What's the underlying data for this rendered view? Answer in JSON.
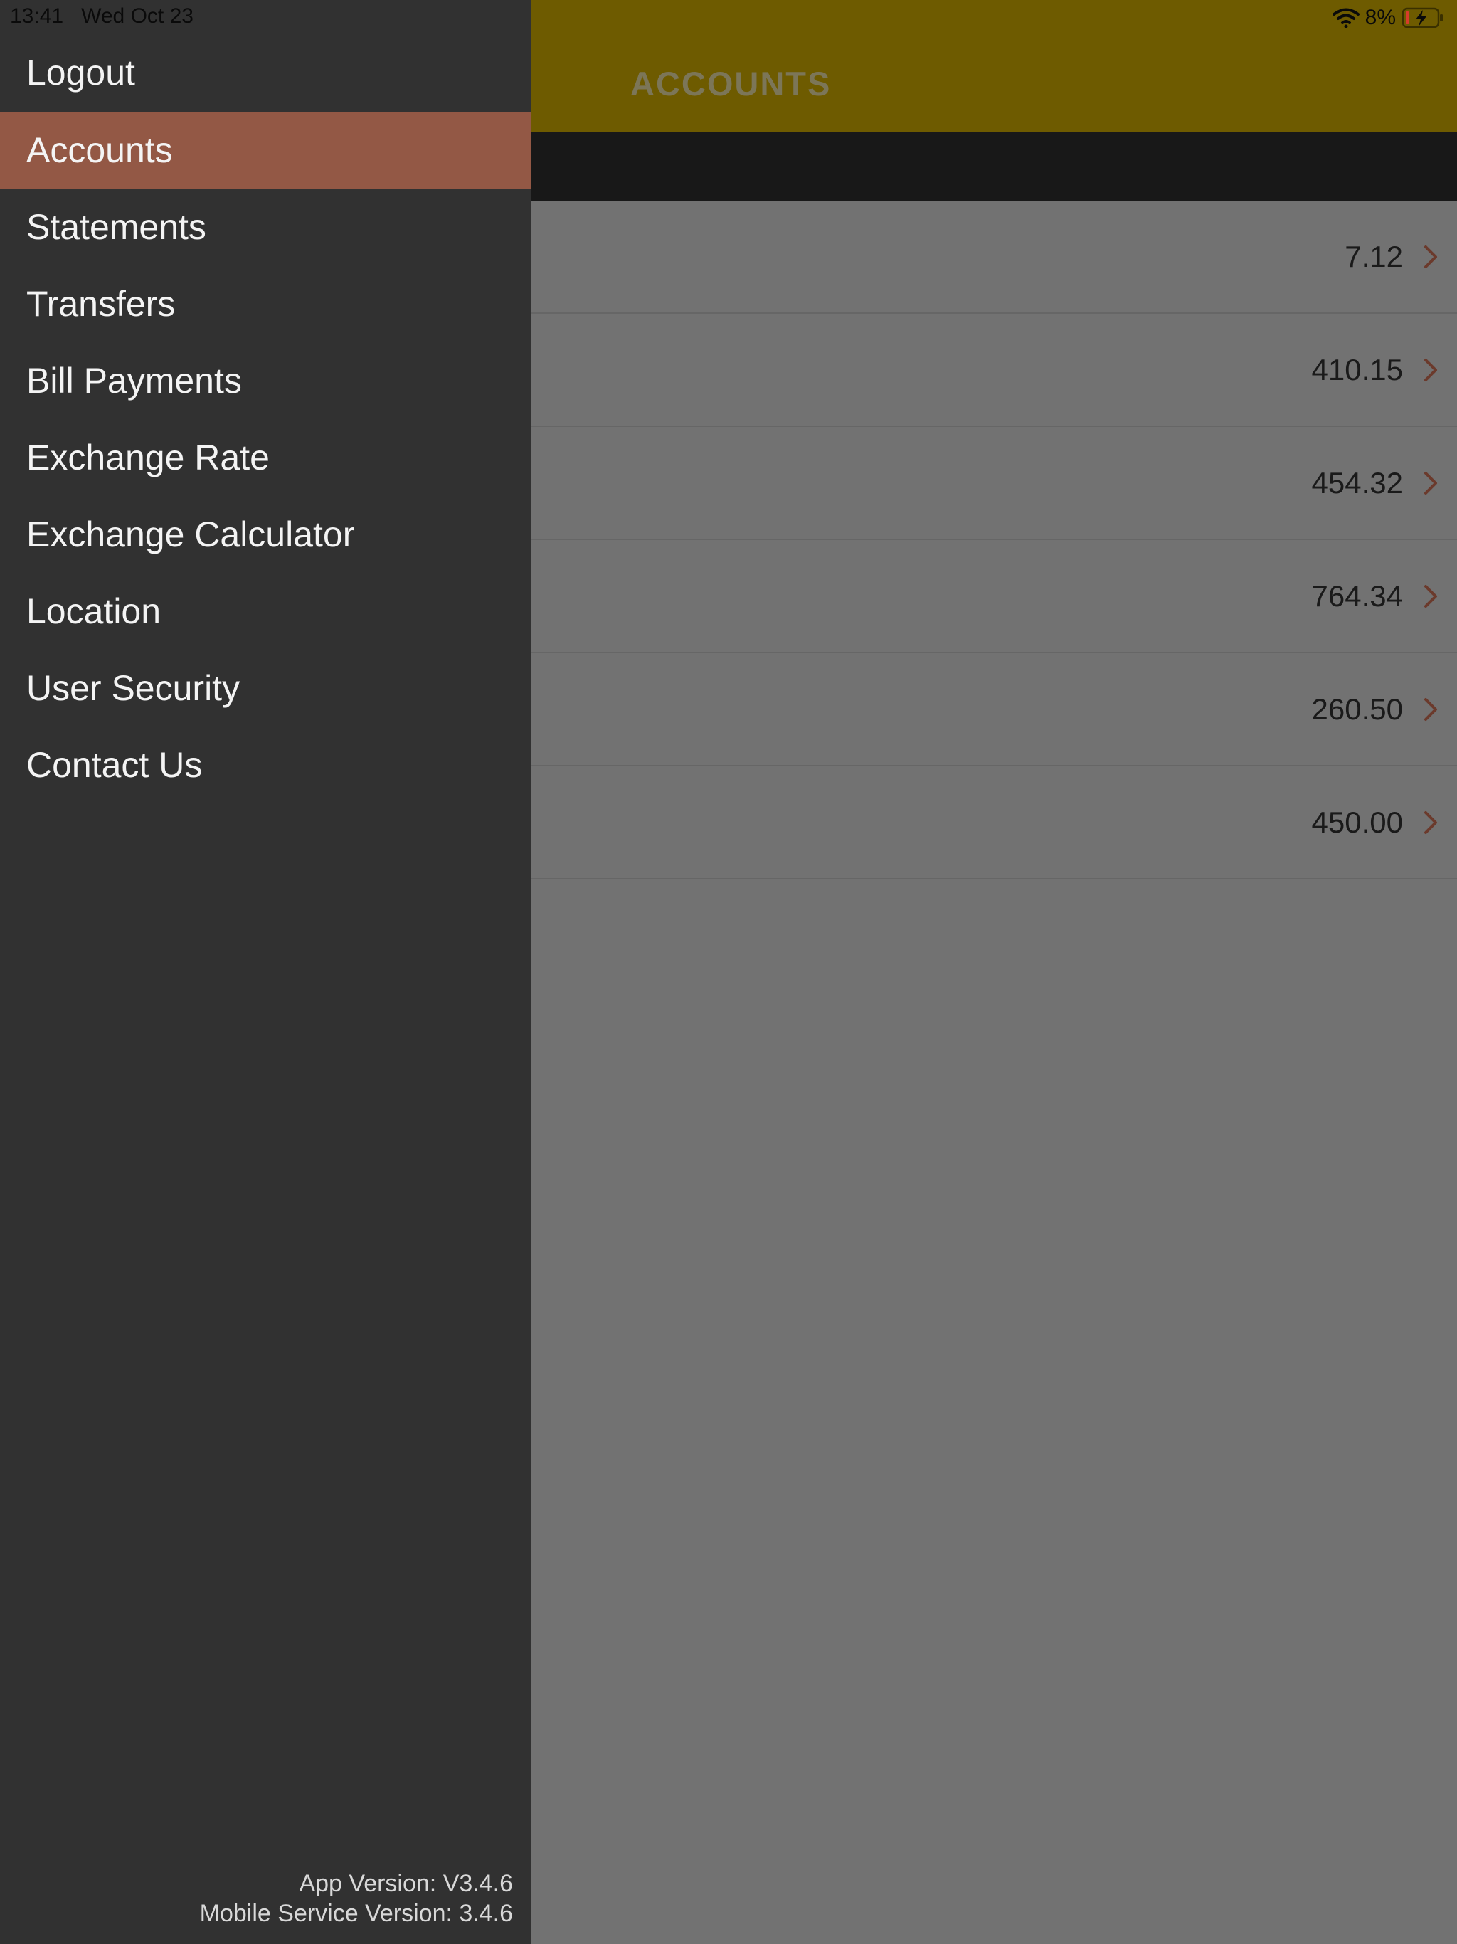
{
  "status_bar": {
    "time": "13:41",
    "date": "Wed Oct 23",
    "battery_percent": "8%"
  },
  "header": {
    "title": "ACCOUNTS"
  },
  "accounts": [
    {
      "amount": "7.12"
    },
    {
      "amount": "410.15"
    },
    {
      "amount": "454.32"
    },
    {
      "amount": "764.34"
    },
    {
      "amount": "260.50"
    },
    {
      "amount": "450.00"
    }
  ],
  "menu": {
    "items": [
      {
        "label": "Logout"
      },
      {
        "label": "Accounts"
      },
      {
        "label": "Statements"
      },
      {
        "label": "Transfers"
      },
      {
        "label": "Bill Payments"
      },
      {
        "label": "Exchange Rate"
      },
      {
        "label": "Exchange Calculator"
      },
      {
        "label": "Location"
      },
      {
        "label": "User Security"
      },
      {
        "label": "Contact Us"
      }
    ],
    "active_item": "Accounts",
    "app_version": "App Version: V3.4.6",
    "service_version": "Mobile Service Version: 3.4.6"
  },
  "colors": {
    "header_bg": "#6e5b00",
    "menu_bg": "#313131",
    "menu_active_bg": "#935845",
    "chevron": "#6b3a2c"
  },
  "icons": [
    "wifi-icon",
    "battery-charging-icon",
    "chevron-right-icon"
  ]
}
